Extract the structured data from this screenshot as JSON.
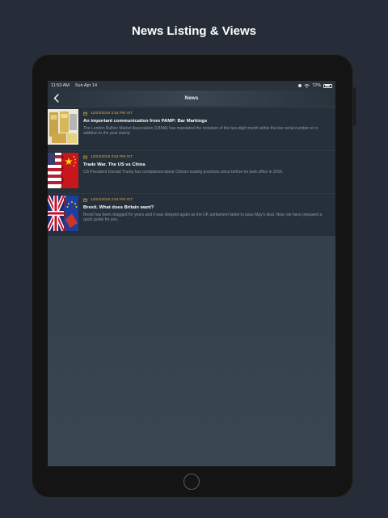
{
  "page_heading": "News Listing & Views",
  "status_bar": {
    "time": "11:53 AM",
    "date": "Sun Apr 14",
    "battery_text": "72%",
    "battery_level": 0.72
  },
  "nav": {
    "title": "News"
  },
  "news": [
    {
      "date": "12/04/2019 3:54 PM IST",
      "title": "An important communication from PAMP: Bar Markings",
      "description": "The London Bullion Market Association (LBMA) has mandated the inclusion of the two-digit month within the bar serial number or in addition to the year stamp."
    },
    {
      "date": "12/04/2019 3:54 PM IST",
      "title": "Trade War. The US vs China",
      "description": "US President Donald Trump has complained about China's trading practices since before he took office in 2016."
    },
    {
      "date": "12/04/2019 3:54 PM IST",
      "title": "Brexit. What does Britain want?",
      "description": "Brexit has been dragged for years and it was delayed again as the UK parliament failed to pass May's deal. Now, we have prepared a quick guide for you."
    }
  ],
  "colors": {
    "accent": "#e0a63a",
    "background": "#262d38",
    "list_background": "#25303a"
  }
}
